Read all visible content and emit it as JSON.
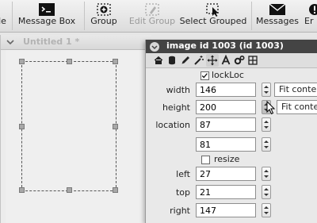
{
  "toolbar": {
    "items": [
      {
        "label": "le",
        "icon": "partial-tool-icon",
        "enabled": true
      },
      {
        "label": "Message Box",
        "icon": "message-box-icon",
        "enabled": true
      },
      {
        "label": "Group",
        "icon": "group-icon",
        "enabled": true
      },
      {
        "label": "Edit Group",
        "icon": "edit-group-icon",
        "enabled": false
      },
      {
        "label": "Select Grouped",
        "icon": "select-grouped-icon",
        "enabled": true
      },
      {
        "label": "Messages",
        "icon": "messages-icon",
        "enabled": true
      },
      {
        "label": "Er",
        "icon": "errors-icon",
        "enabled": true
      }
    ]
  },
  "stack_window": {
    "title": "Untitled 1 *"
  },
  "inspector": {
    "title": "image id 1003 (id 1003)",
    "tabs": [
      "home-icon",
      "database-icon",
      "pencil-icon",
      "wand-icon",
      "move-icon",
      "text-icon",
      "gears-icon",
      "grid-icon"
    ],
    "lockLoc": {
      "label": "lockLoc",
      "checked": true
    },
    "width": {
      "label": "width",
      "value": "146",
      "button": "Fit content"
    },
    "height": {
      "label": "height",
      "value": "200",
      "button": "Fit content"
    },
    "location": {
      "label": "location",
      "x": "87",
      "y": "81"
    },
    "resize": {
      "label": "resize",
      "checked": false
    },
    "left": {
      "label": "left",
      "value": "27"
    },
    "top": {
      "label": "top",
      "value": "21"
    },
    "right": {
      "label": "right",
      "value": "147"
    }
  },
  "colors": {
    "inspector_title_bg": "#444444",
    "toolbar_bg": "#e6e6e6"
  }
}
